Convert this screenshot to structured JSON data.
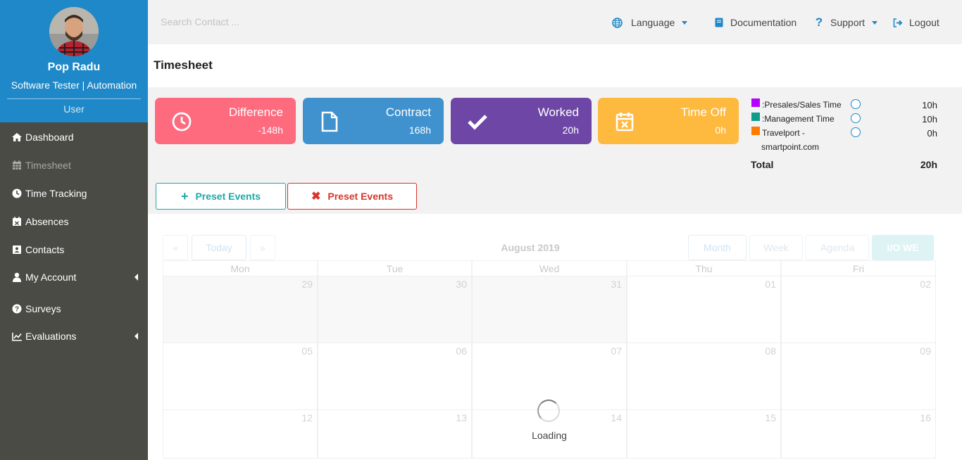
{
  "profile": {
    "name": "Pop Radu",
    "role": "Software Tester | Automation",
    "user_type": "User"
  },
  "sidebar": {
    "items": [
      {
        "label": "Dashboard",
        "icon": "home-icon"
      },
      {
        "label": "Timesheet",
        "icon": "calendar-grid-icon",
        "active": true
      },
      {
        "label": "Time Tracking",
        "icon": "clock-icon"
      },
      {
        "label": "Absences",
        "icon": "calendar-x-icon"
      },
      {
        "label": "Contacts",
        "icon": "address-card-icon"
      },
      {
        "label": "My Account",
        "icon": "user-icon",
        "has_submenu": true
      },
      {
        "label": "Surveys",
        "icon": "question-circle-icon"
      },
      {
        "label": "Evaluations",
        "icon": "line-chart-icon",
        "has_submenu": true
      }
    ]
  },
  "topbar": {
    "search_placeholder": "Search Contact ...",
    "language": "Language",
    "documentation": "Documentation",
    "support": "Support",
    "logout": "Logout"
  },
  "page": {
    "title": "Timesheet"
  },
  "cards": [
    {
      "label": "Difference",
      "value": "-148h",
      "color": "#fe6a7e",
      "icon": "clock-icon"
    },
    {
      "label": "Contract",
      "value": "168h",
      "color": "#3f92ce",
      "icon": "file-icon"
    },
    {
      "label": "Worked",
      "value": "20h",
      "color": "#6e47a6",
      "icon": "check-icon"
    },
    {
      "label": "Time Off",
      "value": "0h",
      "color": "#feb93f",
      "icon": "calendar-x-icon"
    }
  ],
  "legend": {
    "rows": [
      {
        "label": ":Presales/Sales Time",
        "value": "10h",
        "color": "#b400ff"
      },
      {
        "label": ":Management Time",
        "value": "10h",
        "color": "#0f9c8c"
      },
      {
        "label_line1": "Travelport -",
        "label_line2": "smartpoint.com",
        "value": "0h",
        "color": "#ff7b00"
      }
    ],
    "total_label": "Total",
    "total_value": "20h"
  },
  "preset_buttons": {
    "add": "Preset Events",
    "remove": "Preset Events"
  },
  "calendar": {
    "title": "August 2019",
    "nav": {
      "prev": "«",
      "today": "Today",
      "next": "»"
    },
    "views": {
      "month": "Month",
      "week": "Week",
      "agenda": "Agenda",
      "iowe": "I/O WE"
    },
    "weekdays": [
      "Mon",
      "Tue",
      "Wed",
      "Thu",
      "Fri"
    ],
    "weeks": [
      [
        "29",
        "30",
        "31",
        "01",
        "02"
      ],
      [
        "05",
        "06",
        "07",
        "08",
        "09"
      ],
      [
        "12",
        "13",
        "14",
        "15",
        "16"
      ]
    ],
    "loading": "Loading"
  },
  "colors": {
    "sidebar_bg": "#4b4b45",
    "profile_bg": "#1e88c8",
    "accent_teal": "#1fa8a8",
    "accent_red": "#d9342b"
  }
}
